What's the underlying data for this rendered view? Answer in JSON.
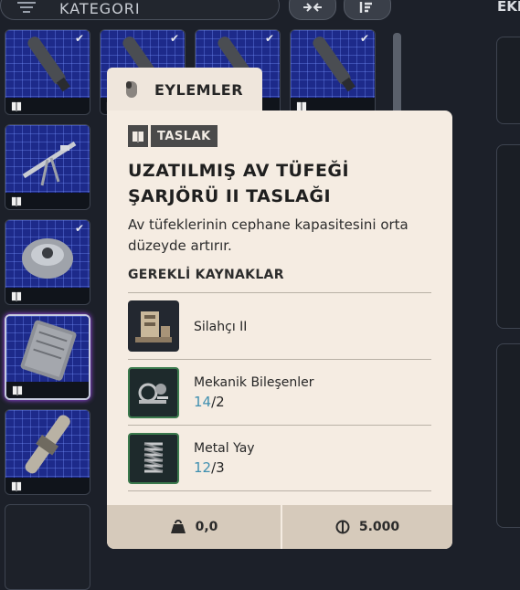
{
  "topbar": {
    "category_label": "KATEGORI",
    "compare_icon": "arrows-inward-icon",
    "sort_icon": "sort-arrows-icon",
    "right_header_fragment": "EKI"
  },
  "grid": {
    "book_icon": "blueprint-book-icon",
    "check_icon": "checkmark-icon",
    "slots": [
      {
        "item": "barrel-part",
        "checked": true
      },
      {
        "item": "barrel-part",
        "checked": true
      },
      {
        "item": "barrel-part",
        "checked": true
      },
      {
        "item": "barrel-part",
        "checked": true
      },
      {
        "item": "tripod-rifle",
        "checked": false
      },
      {
        "item": "scanner-device",
        "checked": true
      },
      {
        "item": "magazine",
        "checked": false,
        "selected": true
      },
      {
        "item": "scope-attachment",
        "checked": false
      }
    ]
  },
  "popup": {
    "tab_label": "EYLEMLER",
    "tab_icon": "mouse-icon",
    "badge_label": "TASLAK",
    "title": "UZATILMIŞ AV TÜFEĞİ ŞARJÖRÜ II TASLAĞI",
    "description": "Av tüfeklerinin cephane kapasitesini orta düzeyde artırır.",
    "requirements_header": "GEREKLİ KAYNAKLAR",
    "requirements": [
      {
        "name": "Silahçı II",
        "icon": "workbench-icon",
        "have": null,
        "need": null
      },
      {
        "name": "Mekanik Bileşenler",
        "icon": "mechanical-parts-icon",
        "have": "14",
        "need": "2"
      },
      {
        "name": "Metal Yay",
        "icon": "spring-icon",
        "have": "12",
        "need": "3"
      }
    ],
    "weight_value": "0,0",
    "price_value": "5.000",
    "weight_icon": "weight-icon",
    "coin_icon": "coin-icon"
  },
  "colors": {
    "grid_tile": "#1d2a8a",
    "popup_bg": "#f5ece2",
    "count_have": "#3f8fb0",
    "selection_glow": "#a84cff"
  }
}
